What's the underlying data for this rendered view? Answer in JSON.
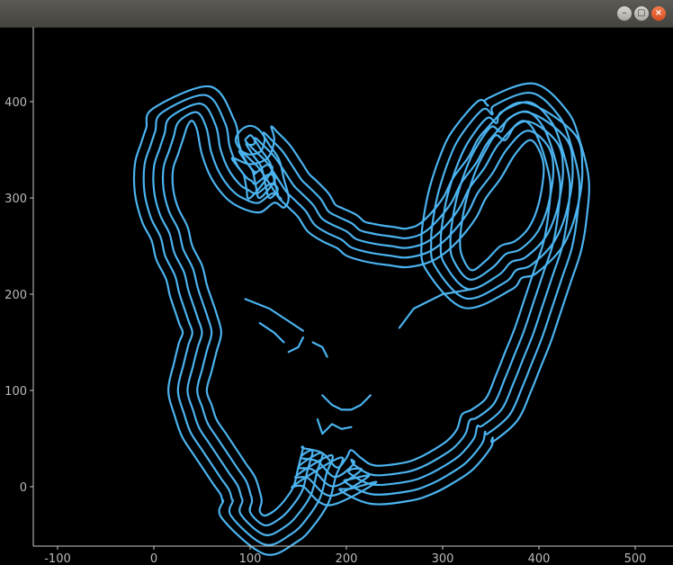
{
  "window": {
    "title": "",
    "buttons": {
      "minimize_icon": "minimize-icon",
      "maximize_icon": "maximize-icon",
      "close_icon": "close-icon",
      "minimize_glyph": "–",
      "maximize_glyph": "▢",
      "close_glyph": "×"
    }
  },
  "chart_data": {
    "type": "line",
    "title": "",
    "xlabel": "",
    "ylabel": "",
    "xlim": [
      -125,
      535
    ],
    "ylim": [
      -60,
      475
    ],
    "xticks": [
      -100,
      0,
      100,
      200,
      300,
      400,
      500
    ],
    "yticks": [
      0,
      100,
      200,
      300,
      400
    ],
    "grid": false,
    "line_color": "#4bb3ef",
    "background": "#000000",
    "offset_levels": [
      0,
      10,
      20,
      30,
      40
    ],
    "series": [
      {
        "x": [
          155,
          175,
          190,
          200,
          205,
          215,
          230,
          260,
          275,
          290,
          305,
          315,
          320,
          330,
          345,
          355,
          365,
          375,
          385,
          395,
          405,
          410,
          412,
          405,
          395,
          385,
          375,
          365,
          355,
          345,
          335,
          325,
          320,
          318,
          320,
          330,
          345,
          360,
          375,
          390,
          400,
          405,
          400,
          390,
          375,
          360,
          345,
          335,
          320,
          305,
          290,
          275,
          260,
          245,
          230,
          215,
          200,
          190,
          175,
          160,
          150,
          140,
          130,
          120,
          110,
          100,
          90,
          85,
          90,
          100,
          110,
          120,
          130,
          135,
          140,
          135,
          125,
          110,
          90,
          75,
          60,
          50,
          45,
          40,
          35,
          30,
          25,
          20,
          20,
          25,
          35,
          40,
          50,
          55,
          60,
          65,
          70,
          65,
          60,
          55,
          60,
          65,
          75,
          85,
          95,
          105,
          110,
          112,
          110,
          115,
          125,
          135,
          145,
          150,
          155
        ],
        "y": [
          40,
          35,
          20,
          30,
          38,
          30,
          22,
          25,
          30,
          38,
          48,
          60,
          75,
          80,
          92,
          115,
          140,
          165,
          195,
          225,
          255,
          285,
          315,
          345,
          370,
          380,
          375,
          360,
          365,
          350,
          330,
          300,
          275,
          255,
          240,
          225,
          235,
          250,
          255,
          270,
          295,
          330,
          350,
          360,
          345,
          320,
          300,
          280,
          260,
          245,
          235,
          230,
          228,
          230,
          232,
          235,
          240,
          248,
          255,
          265,
          280,
          290,
          300,
          315,
          330,
          340,
          350,
          360,
          370,
          375,
          370,
          355,
          340,
          320,
          300,
          290,
          295,
          285,
          290,
          300,
          320,
          345,
          370,
          380,
          375,
          360,
          345,
          330,
          310,
          290,
          270,
          250,
          230,
          210,
          195,
          180,
          160,
          140,
          120,
          100,
          85,
          70,
          55,
          40,
          25,
          10,
          -5,
          -15,
          -25,
          -30,
          -25,
          -15,
          0,
          20,
          40
        ]
      }
    ]
  }
}
